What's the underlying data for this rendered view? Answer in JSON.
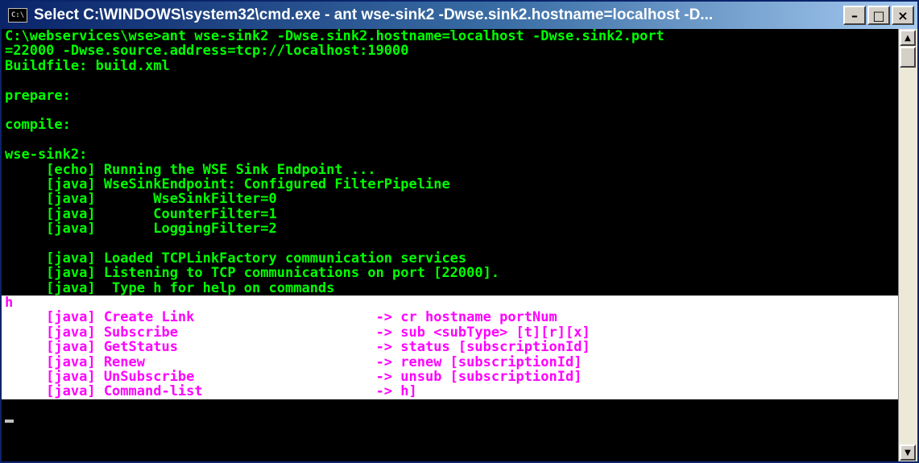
{
  "window": {
    "title": "Select C:\\WINDOWS\\system32\\cmd.exe - ant wse-sink2 -Dwse.sink2.hostname=localhost -D...",
    "icon_label": "C:\\",
    "buttons": {
      "minimize": "–",
      "maximize": "□",
      "close": "×"
    }
  },
  "console": {
    "lines": [
      "C:\\webservices\\wse>ant wse-sink2 -Dwse.sink2.hostname=localhost -Dwse.sink2.port",
      "=22000 -Dwse.source.address=tcp://localhost:19000",
      "Buildfile: build.xml",
      "",
      "prepare:",
      "",
      "compile:",
      "",
      "wse-sink2:",
      "     [echo] Running the WSE Sink Endpoint ...",
      "     [java] WseSinkEndpoint: Configured FilterPipeline",
      "     [java]       WseSinkFilter=0",
      "     [java]       CounterFilter=1",
      "     [java]       LoggingFilter=2",
      "",
      "     [java] Loaded TCPLinkFactory communication services",
      "     [java] Listening to TCP communications on port [22000].",
      "     [java]  Type h for help on commands"
    ],
    "selected_lines": [
      "h",
      "     [java] Create Link                      -> cr hostname portNum",
      "     [java] Subscribe                        -> sub <subType> [t][r][x]",
      "     [java] GetStatus                        -> status [subscriptionId]",
      "     [java] Renew                            -> renew [subscriptionId]",
      "     [java] UnSubscribe                      -> unsub [subscriptionId]",
      "     [java] Command-list                     -> h]"
    ]
  },
  "scrollbar": {
    "up_arrow": "▲",
    "down_arrow": "▼"
  },
  "colors": {
    "console_text": "#00ff00",
    "console_bg": "#000000",
    "selection_bg": "#ffffff",
    "selection_text": "#ff00ff"
  }
}
